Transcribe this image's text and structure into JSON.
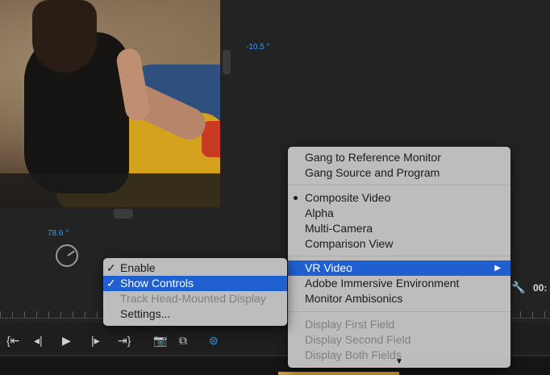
{
  "viewer": {
    "pitch_value": "-10.5 °",
    "yaw_value": "78.6 °",
    "timecode": "00:"
  },
  "main_menu": {
    "items": [
      {
        "label": "Gang to Reference Monitor"
      },
      {
        "label": "Gang Source and Program"
      },
      {
        "label": "Composite Video",
        "selected_radio": true
      },
      {
        "label": "Alpha"
      },
      {
        "label": "Multi-Camera"
      },
      {
        "label": "Comparison View"
      },
      {
        "label": "VR Video",
        "highlighted": true,
        "submenu": true
      },
      {
        "label": "Adobe Immersive Environment"
      },
      {
        "label": "Monitor Ambisonics"
      },
      {
        "label": "Display First Field",
        "disabled": true
      },
      {
        "label": "Display Second Field",
        "disabled": true
      },
      {
        "label": "Display Both Fields",
        "disabled": true
      }
    ]
  },
  "vr_submenu": {
    "items": [
      {
        "label": "Enable",
        "checked": true
      },
      {
        "label": "Show Controls",
        "checked": true,
        "highlighted": true
      },
      {
        "label": "Track Head-Mounted Display",
        "disabled": true
      },
      {
        "label": "Settings..."
      }
    ]
  },
  "glyphs": {
    "check": "✓",
    "submenu_arrow": "▶",
    "more_arrow": "▼"
  },
  "transport": {
    "icons": [
      "mark-in-icon",
      "step-back-icon",
      "play-icon",
      "step-forward-icon",
      "mark-out-icon",
      "camera-icon",
      "compare-icon",
      "vr-headset-icon"
    ]
  },
  "colors": {
    "accent_blue": "#2f9bff",
    "menu_highlight": "#1f5fd0",
    "menu_bg": "#c4c4c4"
  }
}
